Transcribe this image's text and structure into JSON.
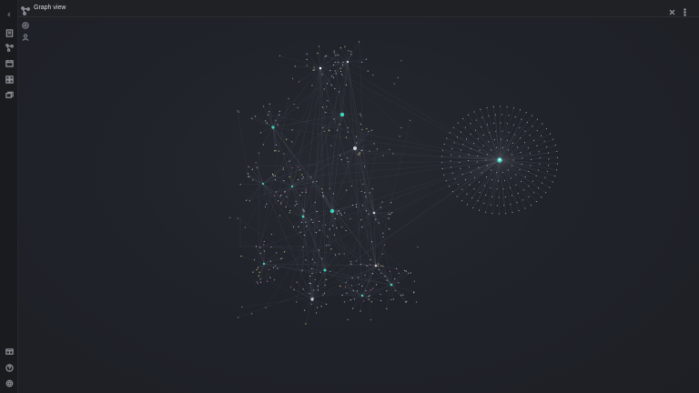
{
  "view": {
    "title": "Graph view"
  },
  "ribbon_icons": [
    "files-icon",
    "graph-icon",
    "calendar-icon",
    "puzzle-icon",
    "layers-icon",
    "vault-icon",
    "help-icon",
    "settings-icon"
  ],
  "colors": {
    "background": "#1e2024",
    "edge": "#6a6f78",
    "node": "#aeb3bb",
    "accent": "#3fd5c0",
    "yellow": "#d8c86a",
    "pink": "#c25a96"
  }
}
